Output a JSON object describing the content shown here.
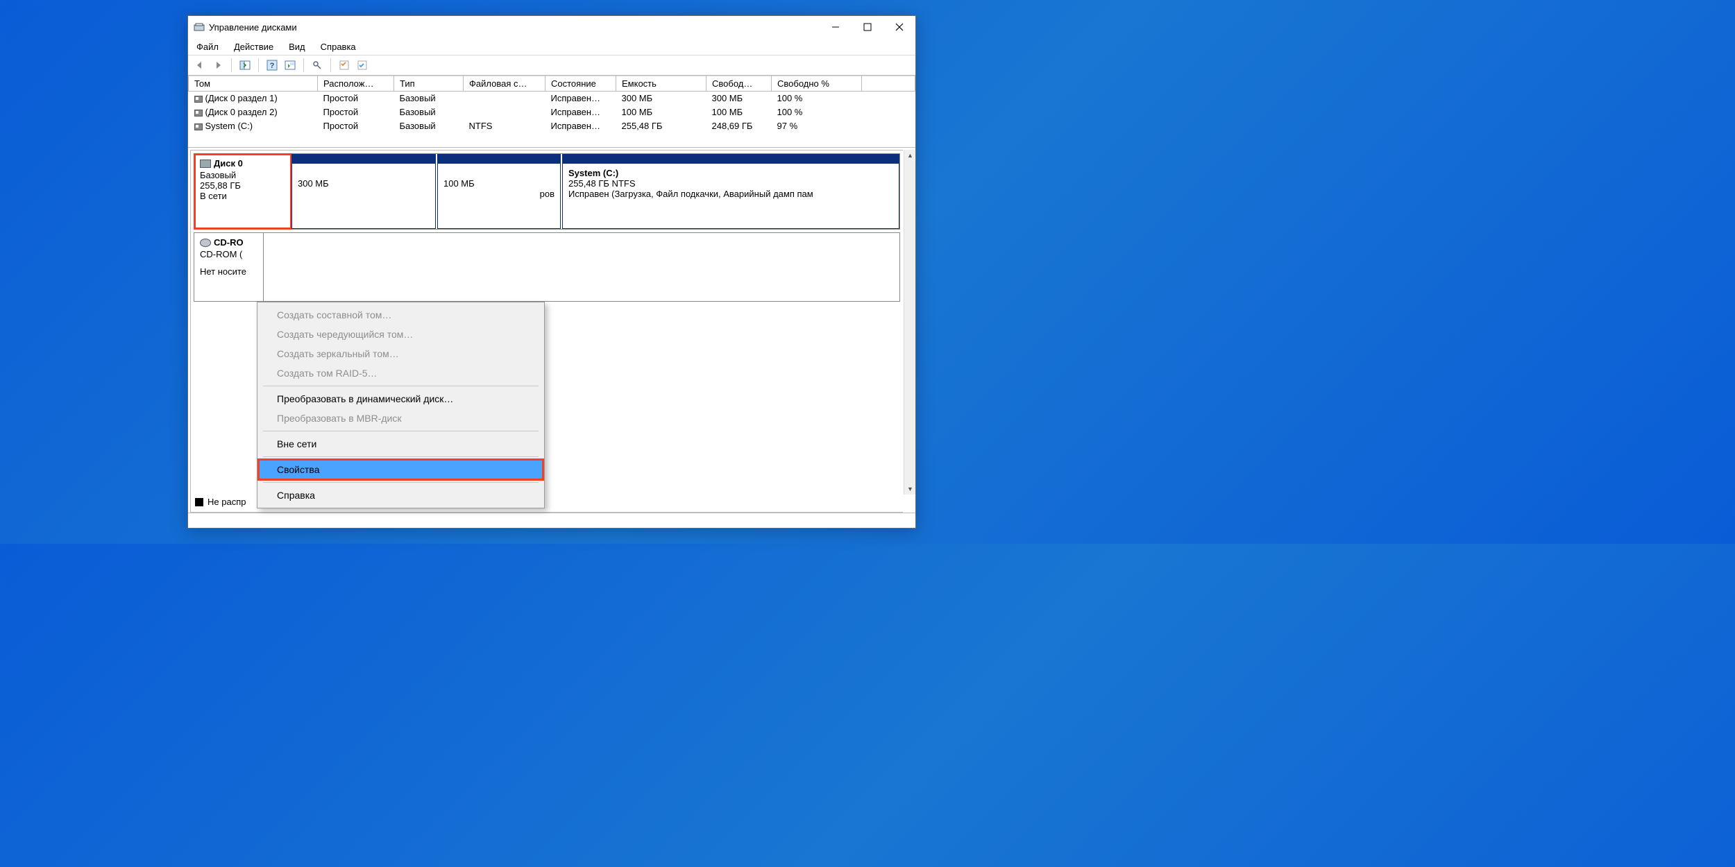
{
  "window": {
    "title": "Управление дисками"
  },
  "menu": {
    "file": "Файл",
    "action": "Действие",
    "view": "Вид",
    "help": "Справка"
  },
  "table": {
    "headers": {
      "volume": "Том",
      "layout": "Располож…",
      "type": "Тип",
      "fs": "Файловая с…",
      "status": "Состояние",
      "capacity": "Емкость",
      "free": "Свобод…",
      "freepct": "Свободно %"
    },
    "rows": [
      {
        "volume": "(Диск 0 раздел 1)",
        "layout": "Простой",
        "type": "Базовый",
        "fs": "",
        "status": "Исправен…",
        "capacity": "300 МБ",
        "free": "300 МБ",
        "freepct": "100 %"
      },
      {
        "volume": "(Диск 0 раздел 2)",
        "layout": "Простой",
        "type": "Базовый",
        "fs": "",
        "status": "Исправен…",
        "capacity": "100 МБ",
        "free": "100 МБ",
        "freepct": "100 %"
      },
      {
        "volume": "System (C:)",
        "layout": "Простой",
        "type": "Базовый",
        "fs": "NTFS",
        "status": "Исправен…",
        "capacity": "255,48 ГБ",
        "free": "248,69 ГБ",
        "freepct": "97 %"
      }
    ]
  },
  "disks": {
    "disk0": {
      "name": "Диск 0",
      "type": "Базовый",
      "size": "255,88 ГБ",
      "status": "В сети",
      "p1_size": "300 МБ",
      "p2_size": "100 МБ",
      "p2_status_suffix": "ров",
      "p3_name": "System  (C:)",
      "p3_line2": "255,48 ГБ NTFS",
      "p3_line3": "Исправен (Загрузка, Файл подкачки, Аварийный дамп пам"
    },
    "cdrom": {
      "name": "CD-RO",
      "line2": "CD-ROM (",
      "line3": "Нет носите"
    }
  },
  "legend": {
    "unalloc": "Не распр"
  },
  "context_menu": {
    "spanned": "Создать составной том…",
    "striped": "Создать чередующийся том…",
    "mirrored": "Создать зеркальный том…",
    "raid5": "Создать том RAID-5…",
    "todynamic": "Преобразовать в динамический диск…",
    "tombr": "Преобразовать в MBR-диск",
    "offline": "Вне сети",
    "properties": "Свойства",
    "help": "Справка"
  }
}
